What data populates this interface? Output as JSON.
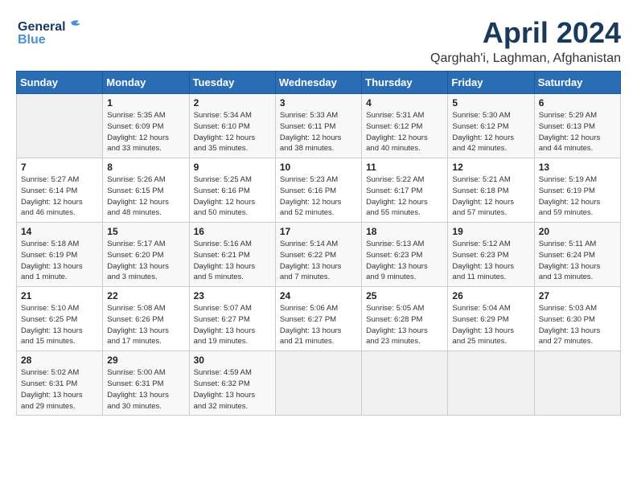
{
  "logo": {
    "line1": "General",
    "line2": "Blue"
  },
  "title": "April 2024",
  "location": "Qarghah'i, Laghman, Afghanistan",
  "days_of_week": [
    "Sunday",
    "Monday",
    "Tuesday",
    "Wednesday",
    "Thursday",
    "Friday",
    "Saturday"
  ],
  "weeks": [
    [
      {
        "day": "",
        "info": ""
      },
      {
        "day": "1",
        "info": "Sunrise: 5:35 AM\nSunset: 6:09 PM\nDaylight: 12 hours\nand 33 minutes."
      },
      {
        "day": "2",
        "info": "Sunrise: 5:34 AM\nSunset: 6:10 PM\nDaylight: 12 hours\nand 35 minutes."
      },
      {
        "day": "3",
        "info": "Sunrise: 5:33 AM\nSunset: 6:11 PM\nDaylight: 12 hours\nand 38 minutes."
      },
      {
        "day": "4",
        "info": "Sunrise: 5:31 AM\nSunset: 6:12 PM\nDaylight: 12 hours\nand 40 minutes."
      },
      {
        "day": "5",
        "info": "Sunrise: 5:30 AM\nSunset: 6:12 PM\nDaylight: 12 hours\nand 42 minutes."
      },
      {
        "day": "6",
        "info": "Sunrise: 5:29 AM\nSunset: 6:13 PM\nDaylight: 12 hours\nand 44 minutes."
      }
    ],
    [
      {
        "day": "7",
        "info": "Sunrise: 5:27 AM\nSunset: 6:14 PM\nDaylight: 12 hours\nand 46 minutes."
      },
      {
        "day": "8",
        "info": "Sunrise: 5:26 AM\nSunset: 6:15 PM\nDaylight: 12 hours\nand 48 minutes."
      },
      {
        "day": "9",
        "info": "Sunrise: 5:25 AM\nSunset: 6:16 PM\nDaylight: 12 hours\nand 50 minutes."
      },
      {
        "day": "10",
        "info": "Sunrise: 5:23 AM\nSunset: 6:16 PM\nDaylight: 12 hours\nand 52 minutes."
      },
      {
        "day": "11",
        "info": "Sunrise: 5:22 AM\nSunset: 6:17 PM\nDaylight: 12 hours\nand 55 minutes."
      },
      {
        "day": "12",
        "info": "Sunrise: 5:21 AM\nSunset: 6:18 PM\nDaylight: 12 hours\nand 57 minutes."
      },
      {
        "day": "13",
        "info": "Sunrise: 5:19 AM\nSunset: 6:19 PM\nDaylight: 12 hours\nand 59 minutes."
      }
    ],
    [
      {
        "day": "14",
        "info": "Sunrise: 5:18 AM\nSunset: 6:19 PM\nDaylight: 13 hours\nand 1 minute."
      },
      {
        "day": "15",
        "info": "Sunrise: 5:17 AM\nSunset: 6:20 PM\nDaylight: 13 hours\nand 3 minutes."
      },
      {
        "day": "16",
        "info": "Sunrise: 5:16 AM\nSunset: 6:21 PM\nDaylight: 13 hours\nand 5 minutes."
      },
      {
        "day": "17",
        "info": "Sunrise: 5:14 AM\nSunset: 6:22 PM\nDaylight: 13 hours\nand 7 minutes."
      },
      {
        "day": "18",
        "info": "Sunrise: 5:13 AM\nSunset: 6:23 PM\nDaylight: 13 hours\nand 9 minutes."
      },
      {
        "day": "19",
        "info": "Sunrise: 5:12 AM\nSunset: 6:23 PM\nDaylight: 13 hours\nand 11 minutes."
      },
      {
        "day": "20",
        "info": "Sunrise: 5:11 AM\nSunset: 6:24 PM\nDaylight: 13 hours\nand 13 minutes."
      }
    ],
    [
      {
        "day": "21",
        "info": "Sunrise: 5:10 AM\nSunset: 6:25 PM\nDaylight: 13 hours\nand 15 minutes."
      },
      {
        "day": "22",
        "info": "Sunrise: 5:08 AM\nSunset: 6:26 PM\nDaylight: 13 hours\nand 17 minutes."
      },
      {
        "day": "23",
        "info": "Sunrise: 5:07 AM\nSunset: 6:27 PM\nDaylight: 13 hours\nand 19 minutes."
      },
      {
        "day": "24",
        "info": "Sunrise: 5:06 AM\nSunset: 6:27 PM\nDaylight: 13 hours\nand 21 minutes."
      },
      {
        "day": "25",
        "info": "Sunrise: 5:05 AM\nSunset: 6:28 PM\nDaylight: 13 hours\nand 23 minutes."
      },
      {
        "day": "26",
        "info": "Sunrise: 5:04 AM\nSunset: 6:29 PM\nDaylight: 13 hours\nand 25 minutes."
      },
      {
        "day": "27",
        "info": "Sunrise: 5:03 AM\nSunset: 6:30 PM\nDaylight: 13 hours\nand 27 minutes."
      }
    ],
    [
      {
        "day": "28",
        "info": "Sunrise: 5:02 AM\nSunset: 6:31 PM\nDaylight: 13 hours\nand 29 minutes."
      },
      {
        "day": "29",
        "info": "Sunrise: 5:00 AM\nSunset: 6:31 PM\nDaylight: 13 hours\nand 30 minutes."
      },
      {
        "day": "30",
        "info": "Sunrise: 4:59 AM\nSunset: 6:32 PM\nDaylight: 13 hours\nand 32 minutes."
      },
      {
        "day": "",
        "info": ""
      },
      {
        "day": "",
        "info": ""
      },
      {
        "day": "",
        "info": ""
      },
      {
        "day": "",
        "info": ""
      }
    ]
  ]
}
